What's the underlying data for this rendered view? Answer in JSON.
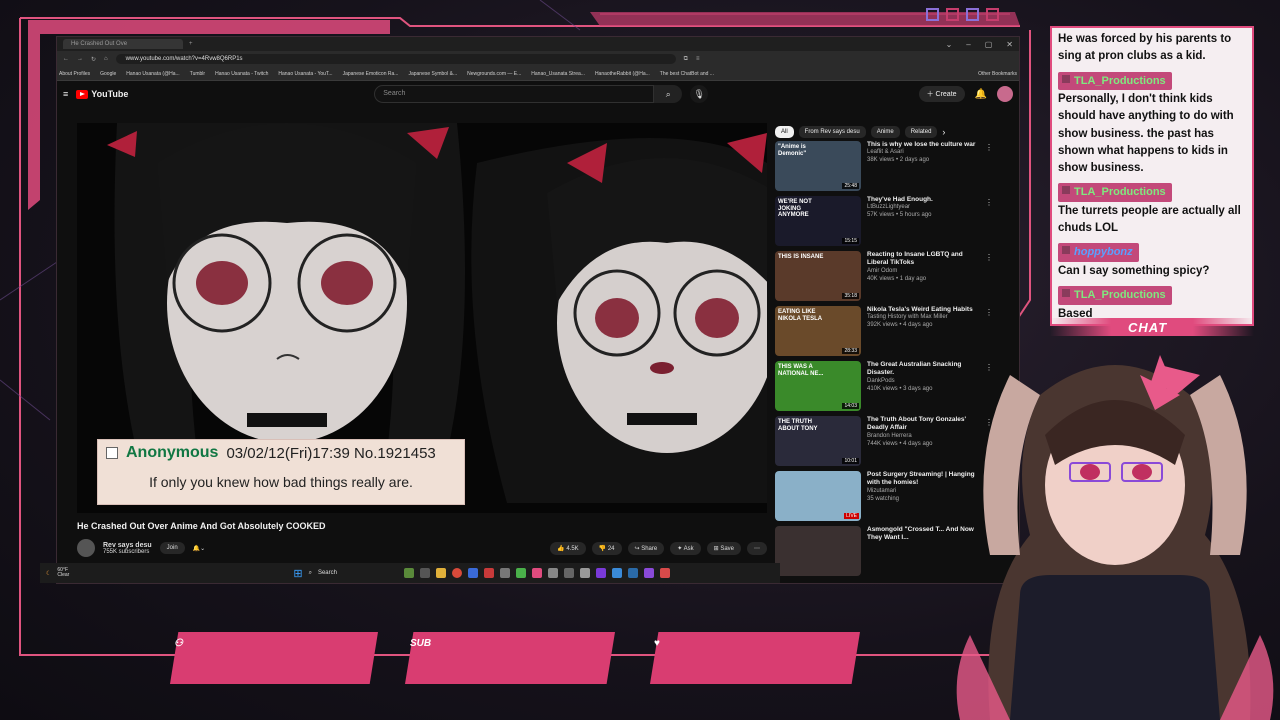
{
  "overlay": {
    "chat_label": "CHAT",
    "sub_label": "SUB"
  },
  "browser": {
    "tab_title": "He Crashed Out Ove",
    "new_tab": "+",
    "window_controls": [
      "⌄",
      "–",
      "▢",
      "✕"
    ],
    "url": "www.youtube.com/watch?v=4Rvw8Q6RP1s",
    "bookmarks": [
      "About Profiles",
      "Google",
      "Hanao Usanata (@Ha...",
      "Tumblr",
      "Hanao Usanata - Twitch",
      "Hanao Usanata - YouT...",
      "Japanese Emoticon Ra...",
      "Japanese Symbol &...",
      "Newgrounds.com — E...",
      "Hanao_Usanata Strea...",
      "HanaotheRabbit (@Ha...",
      "The best ChatBot and ...",
      "Other Bookmarks"
    ]
  },
  "youtube": {
    "logo": "YouTube",
    "search_placeholder": "Search",
    "create": "Create",
    "video": {
      "post_author": "Anonymous",
      "post_meta": "03/02/12(Fri)17:39 No.1921453",
      "post_text": "If only you knew how bad things really are.",
      "title": "He Crashed Out Over Anime And Got Absolutely COOKED",
      "channel": "Rev says desu",
      "subscribers": "755K subscribers",
      "join": "Join",
      "likes": "4.5K",
      "dislikes": "24",
      "share": "Share",
      "ask": "Ask",
      "save": "Save"
    },
    "chips": [
      "All",
      "From Rev says desu",
      "Anime",
      "Related"
    ],
    "recommendations": [
      {
        "title": "This is why we lose the culture war",
        "channel": "Leaflit & Asari",
        "meta": "38K views • 2 days ago",
        "duration": "25:48",
        "color": "#3a4a5a",
        "thumb_text": "\"Anime is Demonic\""
      },
      {
        "title": "They've Had Enough.",
        "channel": "LtBuzzLightyear",
        "meta": "57K views • 5 hours ago",
        "duration": "15:15",
        "color": "#1a1a2a",
        "thumb_text": "WE'RE NOT JOKING ANYMORE"
      },
      {
        "title": "Reacting to Insane LGBTQ and Liberal TikToks",
        "channel": "Amir Odom",
        "meta": "40K views • 1 day ago",
        "duration": "35:18",
        "color": "#5a3a2a",
        "thumb_text": "THIS IS INSANE"
      },
      {
        "title": "Nikola Tesla's Weird Eating Habits",
        "channel": "Tasting History with Max Miller",
        "meta": "392K views • 4 days ago",
        "duration": "28:33",
        "color": "#6a4a2a",
        "thumb_text": "EATING LIKE NIKOLA TESLA"
      },
      {
        "title": "The Great Australian Snacking Disaster.",
        "channel": "DankPods",
        "meta": "410K views • 3 days ago",
        "duration": "14:03",
        "color": "#3a8a2a",
        "thumb_text": "THIS WAS A NATIONAL NE..."
      },
      {
        "title": "The Truth About Tony Gonzales' Deadly Affair",
        "channel": "Brandon Herrera",
        "meta": "744K views • 4 days ago",
        "duration": "10:01",
        "color": "#2a2a3a",
        "thumb_text": "THE TRUTH ABOUT TONY"
      },
      {
        "title": "Post Surgery Streaming! | Hanging with the homies!",
        "channel": "Mizutamari",
        "meta": "35 watching",
        "duration": "LIVE",
        "color": "#8ab0c8",
        "thumb_text": ""
      },
      {
        "title": "Asmongold \"Crossed T... And Now They Want I...",
        "channel": "",
        "meta": "",
        "duration": "",
        "color": "#3a3030",
        "thumb_text": ""
      }
    ]
  },
  "taskbar": {
    "weather_temp": "60°F",
    "weather_desc": "Clear",
    "search": "Search"
  },
  "chat": [
    {
      "user": "",
      "text": "He was forced by his parents to sing at pron clubs as a kid."
    },
    {
      "user": "TLA_Productions",
      "text": "Personally, I don't think kids should have anything to do with show business. the past has shown what happens to kids in show business."
    },
    {
      "user": "TLA_Productions",
      "text": "The turrets people are actually all chuds LOL"
    },
    {
      "user": "hoppybonz",
      "text": "Can I say something spicy?",
      "blue": true
    },
    {
      "user": "TLA_Productions",
      "text": "Based"
    }
  ],
  "colors": {
    "accent": "#e04b7e",
    "chat_bg": "#f5eef1",
    "username": "#7fe97f"
  },
  "icons": [
    "search-icon",
    "mic-icon",
    "bell-icon",
    "play-icon",
    "thumbs-up-icon",
    "thumbs-down-icon",
    "share-icon",
    "save-icon",
    "more-icon",
    "windows-start-icon"
  ]
}
